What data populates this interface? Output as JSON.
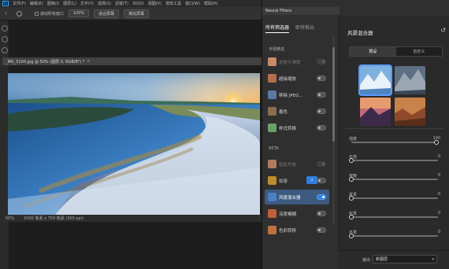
{
  "app": {
    "logo": "Ps",
    "menu": [
      "文件(F)",
      "编辑(E)",
      "图像(I)",
      "图层(L)",
      "文字(Y)",
      "选择(S)",
      "滤镜(T)",
      "3D(D)",
      "视图(V)",
      "增效工具",
      "窗口(W)",
      "帮助(H)"
    ]
  },
  "options_bar": {
    "scroll_all": "滚动所有窗口",
    "zoom": "100%",
    "fit_screen": "适合屏幕",
    "fill_screen": "填充屏幕"
  },
  "document": {
    "tab_title": "_MG_5100.jpg @ 50% (图层 0, RGB/8*) *",
    "status_zoom": "50%",
    "status_info": "1000 像素 x 750 像素 (300 ppi)"
  },
  "panel": {
    "title": "Neural Filters",
    "tabs": [
      "所有筛选器",
      "即将推出"
    ],
    "section_featured": "专题精选",
    "section_beta": "BETA",
    "featured": [
      {
        "label": "皮肤平滑度",
        "state": "disabled",
        "color": "#c98a6a"
      },
      {
        "label": "超级缩放",
        "state": "off",
        "color": "#b76e4f"
      },
      {
        "label": "移除 JPEG...",
        "state": "off",
        "color": "#5c7aa0"
      },
      {
        "label": "着色",
        "state": "off",
        "color": "#8a6f4e"
      },
      {
        "label": "样式转换",
        "state": "off",
        "color": "#6aa06a"
      }
    ],
    "beta": [
      {
        "label": "智能肖像",
        "state": "disabled",
        "color": "#b07a5e"
      },
      {
        "label": "妆容",
        "state": "download",
        "color": "#c08a30",
        "badge": "↓"
      },
      {
        "label": "风景混合器",
        "state": "on",
        "color": "#4a7fc0"
      },
      {
        "label": "深度模糊",
        "state": "off",
        "color": "#c0603a"
      },
      {
        "label": "色彩转移",
        "state": "off",
        "color": "#c07040"
      }
    ]
  },
  "settings": {
    "title": "风景混合器",
    "reset_icon": "↺",
    "segments": [
      "预设",
      "自定义"
    ],
    "sliders": [
      {
        "label": "强度",
        "value": "100",
        "percent": 100
      },
      {
        "label": "日落",
        "value": "0",
        "percent": 0
      },
      {
        "label": "夜晚",
        "value": "0",
        "percent": 0
      },
      {
        "label": "夏季",
        "value": "0",
        "percent": 0
      },
      {
        "label": "秋季",
        "value": "0",
        "percent": 0
      },
      {
        "label": "冬季",
        "value": "0",
        "percent": 0
      }
    ],
    "output_label": "输出",
    "output_value": "新图层"
  }
}
